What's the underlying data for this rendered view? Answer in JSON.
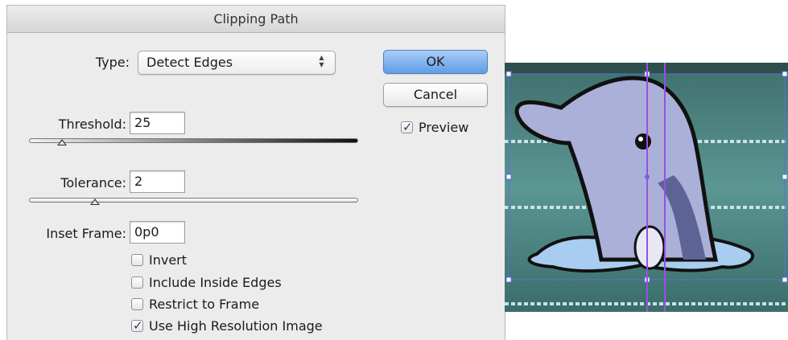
{
  "dialog": {
    "title": "Clipping Path",
    "type": {
      "label": "Type:",
      "value": "Detect Edges"
    },
    "threshold": {
      "label": "Threshold:",
      "value": "25",
      "slider_fraction": 0.1
    },
    "tolerance": {
      "label": "Tolerance:",
      "value": "2",
      "slider_fraction": 0.2
    },
    "inset_frame": {
      "label": "Inset Frame:",
      "value": "0p0"
    },
    "options": [
      {
        "label": "Invert",
        "checked": false
      },
      {
        "label": "Include Inside Edges",
        "checked": false
      },
      {
        "label": "Restrict to Frame",
        "checked": false
      },
      {
        "label": "Use High Resolution Image",
        "checked": true
      }
    ],
    "buttons": {
      "ok": "OK",
      "cancel": "Cancel"
    },
    "preview": {
      "label": "Preview",
      "checked": true
    }
  },
  "icons": {
    "select_arrows": "↕",
    "check": "✓"
  },
  "colors": {
    "primary_button": "#6aa5ea",
    "selection_frame": "#5b6fd6",
    "guide_line": "#9a4fe0",
    "water": "#4f8a87"
  }
}
